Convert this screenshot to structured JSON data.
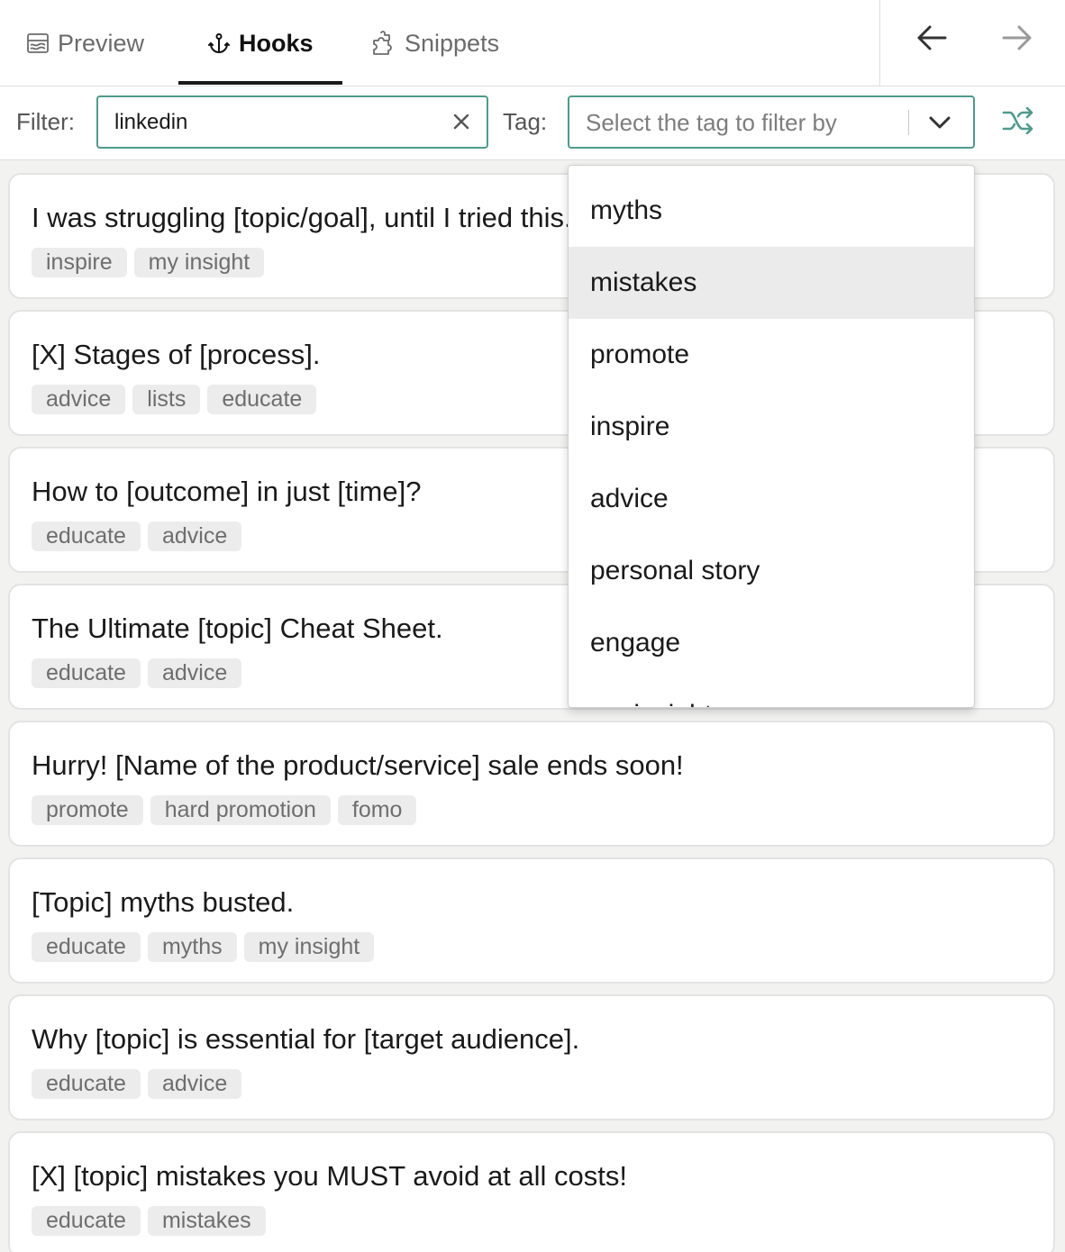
{
  "tabs": [
    {
      "label": "Preview",
      "icon": "preview-icon",
      "active": false
    },
    {
      "label": "Hooks",
      "icon": "anchor-icon",
      "active": true
    },
    {
      "label": "Snippets",
      "icon": "puzzle-icon",
      "active": false
    }
  ],
  "nav": {
    "back_icon": "arrow-left-icon",
    "forward_icon": "arrow-right-icon"
  },
  "filter": {
    "label": "Filter:",
    "value": "linkedin",
    "clear_icon": "close-icon"
  },
  "tag": {
    "label": "Tag:",
    "placeholder": "Select the tag to filter by",
    "options": [
      "myths",
      "mistakes",
      "promote",
      "inspire",
      "advice",
      "personal story",
      "engage",
      "my insight"
    ],
    "highlighted": "mistakes"
  },
  "shuffle_icon": "shuffle-icon",
  "accent_color": "#4f9a8c",
  "hooks": [
    {
      "title": "I was struggling [topic/goal], until I tried this.",
      "tags": [
        "inspire",
        "my insight"
      ]
    },
    {
      "title": "[X] Stages of [process].",
      "tags": [
        "advice",
        "lists",
        "educate"
      ]
    },
    {
      "title": "How to [outcome] in just [time]?",
      "tags": [
        "educate",
        "advice"
      ]
    },
    {
      "title": "The Ultimate [topic] Cheat Sheet.",
      "tags": [
        "educate",
        "advice"
      ]
    },
    {
      "title": "Hurry! [Name of the product/service] sale ends soon!",
      "tags": [
        "promote",
        "hard promotion",
        "fomo"
      ]
    },
    {
      "title": "[Topic] myths busted.",
      "tags": [
        "educate",
        "myths",
        "my insight"
      ]
    },
    {
      "title": "Why [topic] is essential for [target audience].",
      "tags": [
        "educate",
        "advice"
      ]
    },
    {
      "title": "[X] [topic] mistakes you MUST avoid at all costs!",
      "tags": [
        "educate",
        "mistakes"
      ]
    }
  ]
}
